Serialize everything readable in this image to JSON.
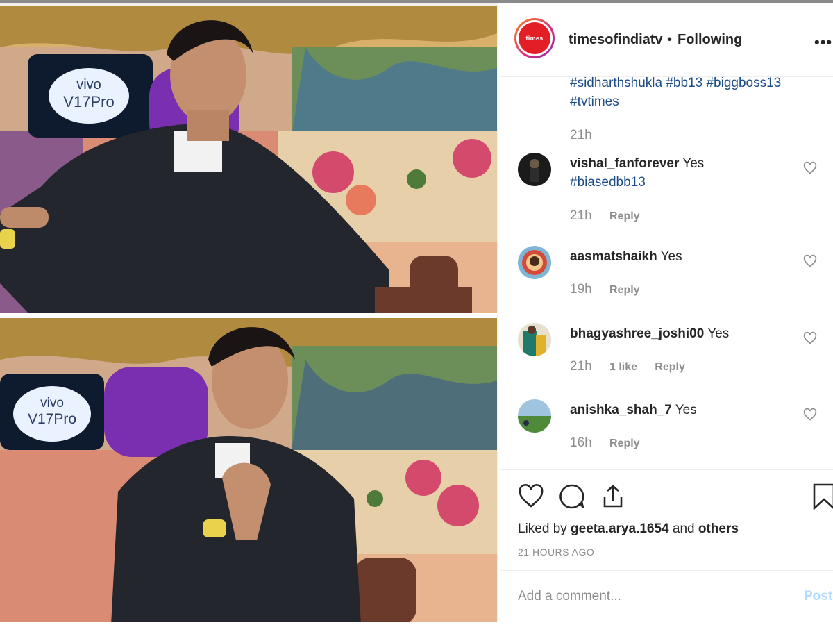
{
  "media": {
    "top_frame": {
      "tv_brand": "vivo",
      "tv_model": "V17Pro"
    },
    "bottom_frame": {
      "tv_brand": "vivo",
      "tv_model": "V17Pro"
    }
  },
  "header": {
    "avatar_label": "times",
    "username": "timesofindiatv",
    "separator": "•",
    "follow_status": "Following",
    "more_icon": "more-horizontal-icon"
  },
  "caption": {
    "line1": "#sidharthshukla #bb13 #biggboss13",
    "line2": "#tvtimes",
    "time": "21h"
  },
  "comments": [
    {
      "user": "vishal_fanforever",
      "text": "Yes",
      "tag": "#biasedbb13",
      "time": "21h",
      "likes": "",
      "reply": "Reply"
    },
    {
      "user": "aasmatshaikh",
      "text": "Yes",
      "tag": "",
      "time": "19h",
      "likes": "",
      "reply": "Reply"
    },
    {
      "user": "bhagyashree_joshi00",
      "text": "Yes",
      "tag": "",
      "time": "21h",
      "likes": "1 like",
      "reply": "Reply"
    },
    {
      "user": "anishka_shah_7",
      "text": "Yes",
      "tag": "",
      "time": "16h",
      "likes": "",
      "reply": "Reply"
    }
  ],
  "actions": {
    "liked_prefix": "Liked by ",
    "liked_user": "geeta.arya.1654",
    "liked_and": " and ",
    "liked_others": "others",
    "posted_time": "21 HOURS AGO"
  },
  "comment_box": {
    "placeholder": "Add a comment...",
    "post_label": "Post"
  },
  "colors": {
    "link": "#1c4c87",
    "muted": "#8e8e8e",
    "post_disabled": "#b3dbff",
    "brand_red": "#e41e26"
  }
}
